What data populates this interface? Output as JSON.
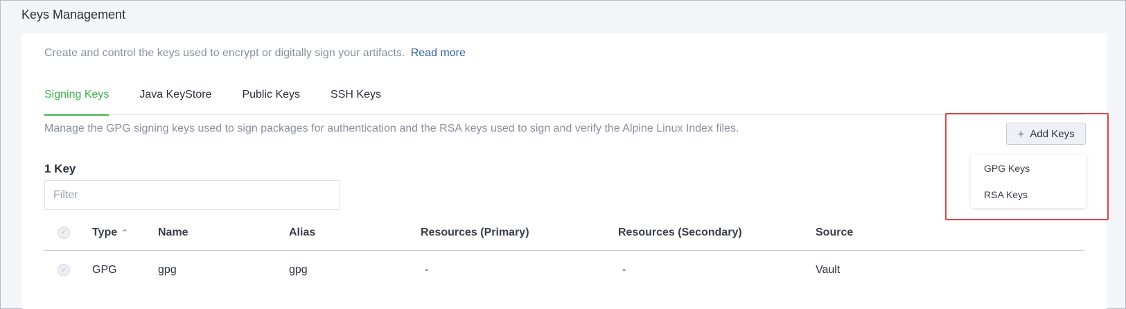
{
  "page": {
    "title": "Keys Management"
  },
  "intro": {
    "text": "Create and control the keys used to encrypt or digitally sign your artifacts.",
    "link": "Read more"
  },
  "tabs": [
    {
      "label": "Signing Keys",
      "active": true
    },
    {
      "label": "Java KeyStore",
      "active": false
    },
    {
      "label": "Public Keys",
      "active": false
    },
    {
      "label": "SSH Keys",
      "active": false
    }
  ],
  "description": "Manage the GPG signing keys used to sign packages for authentication and the RSA keys used to sign and verify the Alpine Linux Index files.",
  "count_label": "1 Key",
  "filter": {
    "placeholder": "Filter",
    "value": ""
  },
  "add_button": {
    "label": "Add Keys",
    "icon": "plus-icon"
  },
  "dropdown": {
    "items": [
      "GPG Keys",
      "RSA Keys"
    ]
  },
  "table": {
    "columns": [
      "Type",
      "Name",
      "Alias",
      "Resources (Primary)",
      "Resources (Secondary)",
      "Source"
    ],
    "sort": {
      "column": "Type",
      "direction": "ascending"
    },
    "rows": [
      {
        "type": "GPG",
        "name": "gpg",
        "alias": "gpg",
        "primary": "-",
        "secondary": "-",
        "source": "Vault"
      }
    ]
  },
  "colors": {
    "accent": "#3ab14a",
    "link": "#2c63a8",
    "highlight": "#e24343"
  }
}
